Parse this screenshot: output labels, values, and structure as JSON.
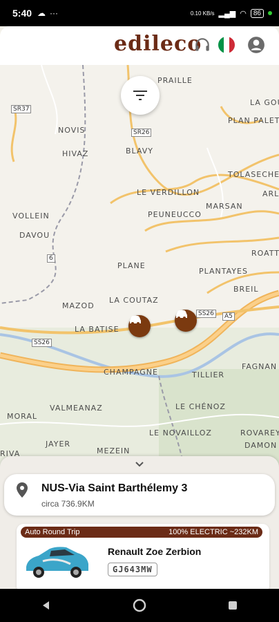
{
  "status": {
    "time": "5:40",
    "battery": "86",
    "net_speed": "0.10 KB/s"
  },
  "header": {
    "logo": "edileco",
    "flag_colors": [
      "#009246",
      "#ffffff",
      "#ce2b37"
    ]
  },
  "map": {
    "places": [
      "PRAILLE",
      "LA GOU",
      "NOVIS",
      "HIVAZ",
      "BLAVY",
      "PLAN PALET",
      "TOLASECHE",
      "ARL",
      "LE VERDILLON",
      "MARSAN",
      "VOLLEIN",
      "PEUNEUCCO",
      "DAVOU",
      "ROATT",
      "PLANE",
      "PLANTAYES",
      "BREIL",
      "LA COUTAZ",
      "MAZOD",
      "LA BATISE",
      "FAGNAN",
      "CHAMPAGNE",
      "TILLIER",
      "VALMEANAZ",
      "LE CHÉNOZ",
      "MORAL",
      "ROVAREY",
      "LE NOVAILLOZ",
      "DAMON",
      "JAYER",
      "MEZEIN",
      "RIVA"
    ],
    "shields": [
      "SR37",
      "SR26",
      "6",
      "SS26",
      "A5",
      "SS26"
    ],
    "marker_color": "#7b3a10"
  },
  "location": {
    "name": "NUS-Via Saint Barthélemy 3",
    "distance": "circa 736.9KM"
  },
  "vehicle": {
    "left_tag": "Auto Round Trip",
    "right_tag": "100% ELECTRIC ~232KM",
    "name": "Renault Zoe Zerbion",
    "plate": "GJ643MW"
  },
  "colors": {
    "brand": "#6b2b16",
    "road": "#f2c36b"
  }
}
